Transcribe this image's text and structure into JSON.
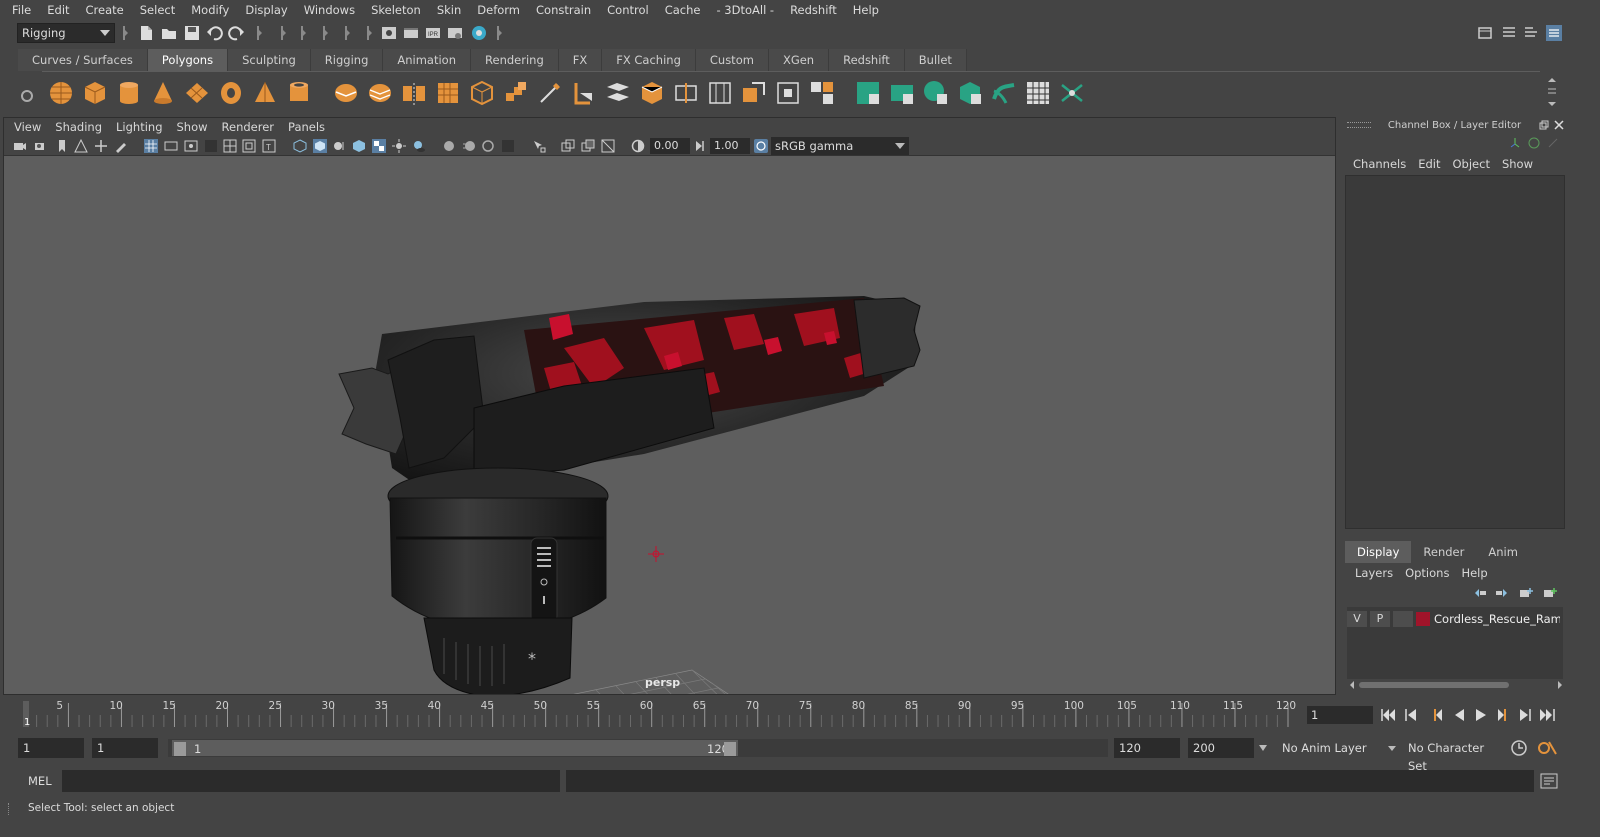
{
  "menubar": [
    "File",
    "Edit",
    "Create",
    "Select",
    "Modify",
    "Display",
    "Windows",
    "Skeleton",
    "Skin",
    "Deform",
    "Constrain",
    "Control",
    "Cache",
    "- 3DtoAll -",
    "Redshift",
    "Help"
  ],
  "statusline": {
    "mode": "Rigging"
  },
  "shelf": {
    "tabs": [
      "Curves / Surfaces",
      "Polygons",
      "Sculpting",
      "Rigging",
      "Animation",
      "Rendering",
      "FX",
      "FX Caching",
      "Custom",
      "XGen",
      "Redshift",
      "Bullet"
    ],
    "active_tab": "Polygons"
  },
  "viewport": {
    "menu": [
      "View",
      "Shading",
      "Lighting",
      "Show",
      "Renderer",
      "Panels"
    ],
    "exposure": "0.00",
    "gamma": "1.00",
    "color_space": "sRGB gamma",
    "camera_label": "persp"
  },
  "right_panel": {
    "title": "Channel Box / Layer Editor",
    "channel_menu": [
      "Channels",
      "Edit",
      "Object",
      "Show"
    ],
    "layer_tabs": [
      "Display",
      "Render",
      "Anim"
    ],
    "layer_tab_active": "Display",
    "layer_menu": [
      "Layers",
      "Options",
      "Help"
    ],
    "layer": {
      "v": "V",
      "p": "P",
      "name": "Cordless_Rescue_Ram_H",
      "color": "#a0142a"
    }
  },
  "timeline": {
    "ticks": [
      "5",
      "10",
      "15",
      "20",
      "25",
      "30",
      "35",
      "40",
      "45",
      "50",
      "55",
      "60",
      "65",
      "70",
      "75",
      "80",
      "85",
      "90",
      "95",
      "100",
      "105",
      "110",
      "115",
      "120"
    ],
    "start_marker": "1",
    "current_frame": "1"
  },
  "range": {
    "start": "1",
    "playback_start": "1",
    "range_start": "1",
    "range_end": "120",
    "playback_end": "120",
    "end": "200",
    "anim_layer": "No Anim Layer",
    "character_set": "No Character Set"
  },
  "command": {
    "label": "MEL"
  },
  "help": {
    "text": "Select Tool: select an object"
  },
  "colors": {
    "accent_red": "#c8102e",
    "selection_green": "#29a384",
    "shelf_orange": "#e4933c"
  }
}
